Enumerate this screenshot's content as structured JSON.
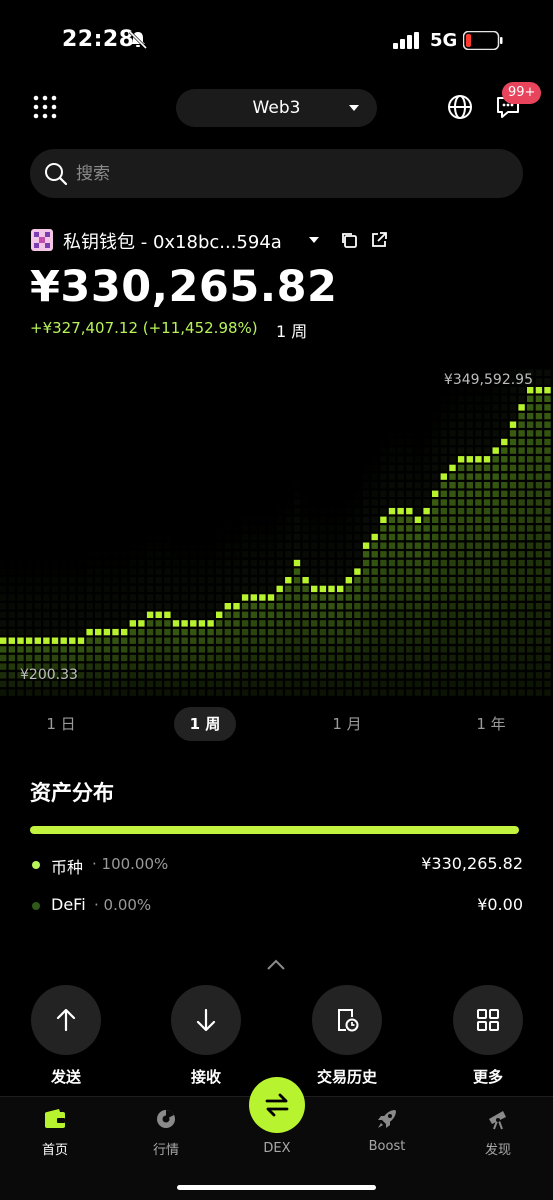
{
  "status_bar": {
    "time": "22:28",
    "network": "5G"
  },
  "header": {
    "network_selector": "Web3",
    "notification_badge": "99+"
  },
  "search": {
    "placeholder": "搜索"
  },
  "wallet": {
    "name": "私钥钱包 - 0x18bc...594a",
    "balance": "¥330,265.82",
    "change": "+¥327,407.12 (+11,452.98%)",
    "change_period": "1 周"
  },
  "chart_data": {
    "type": "line",
    "max_label": "¥349,592.95",
    "min_label": "¥200.33",
    "points": [
      6,
      6,
      6,
      6,
      6,
      6,
      7,
      7,
      7,
      7,
      8,
      8,
      9,
      10,
      10,
      11,
      12,
      13,
      15,
      14,
      11,
      11,
      11,
      11,
      12,
      15,
      17,
      18,
      19,
      19,
      20,
      20,
      22,
      26,
      30,
      24,
      21,
      21,
      22,
      22,
      24,
      29,
      35,
      40,
      44,
      46,
      46,
      46,
      44,
      48,
      52,
      57,
      61,
      63,
      63,
      64,
      64,
      65,
      70,
      75,
      80,
      84,
      85,
      85
    ]
  },
  "tabs": [
    {
      "label": "1 日"
    },
    {
      "label": "1 周"
    },
    {
      "label": "1 月"
    },
    {
      "label": "1 年"
    }
  ],
  "assets": {
    "title": "资产分布",
    "rows": [
      {
        "name": "币种",
        "pct": "· 100.00%",
        "amount": "¥330,265.82",
        "color": "#b8f35a"
      },
      {
        "name": "DeFi",
        "pct": "· 0.00%",
        "amount": "¥0.00",
        "color": "#2f5a1a"
      }
    ]
  },
  "actions": [
    {
      "label": "发送",
      "icon": "arrow-up-icon"
    },
    {
      "label": "接收",
      "icon": "arrow-down-icon"
    },
    {
      "label": "交易历史",
      "icon": "history-icon"
    },
    {
      "label": "更多",
      "icon": "grid-icon"
    }
  ],
  "nav": [
    {
      "label": "首页",
      "icon": "wallet-icon"
    },
    {
      "label": "行情",
      "icon": "market-icon"
    },
    {
      "label": "DEX",
      "icon": "swap-icon"
    },
    {
      "label": "Boost",
      "icon": "rocket-icon"
    },
    {
      "label": "发现",
      "icon": "telescope-icon"
    }
  ],
  "colors": {
    "accent": "#b8f32f",
    "badge": "#e8455d"
  }
}
